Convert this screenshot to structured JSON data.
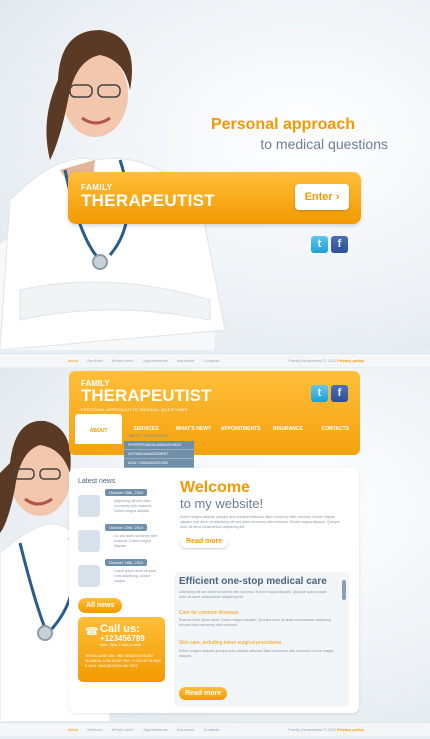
{
  "hero": {
    "tagline_line1": "Personal approach",
    "tagline_line2": "to medical questions",
    "brand_small": "FAMILY",
    "brand_big": "THERAPEUTIST",
    "enter_label": "Enter ›",
    "twitter_glyph": "t",
    "facebook_glyph": "f"
  },
  "footer": {
    "links": [
      "about",
      "Services",
      "What's new?",
      "Appointments",
      "Insurance",
      "Contacts"
    ],
    "copyright": "Family therapeutist © 2011",
    "privacy": "Privacy policy"
  },
  "inner": {
    "brand_small": "FAMILY",
    "brand_big": "THERAPEUTIST",
    "brand_sub": "PERSONAL APPROACH TO MEDICAL QUESTIONS",
    "nav": [
      "ABOUT",
      "SERVICES",
      "WHAT'S NEW?",
      "APPOINTMENTS",
      "INSURANCE",
      "CONTACTS"
    ],
    "dropdown": [
      "OBESITY MANAGEMENT",
      "HYPERTENSION MANAGEMENT",
      "ASTHMA MANAGEMENT",
      "ADULT IMMUNIZATIONS"
    ],
    "latest_news": "Latest news",
    "news": [
      {
        "date": "October 28th, 2010",
        "text": "Adipiscing elit sed diam nonummy nibh euismod. Dolore magna aliquam."
      },
      {
        "date": "October 20th, 2010",
        "text": "Cu sed diam nonummy nibh euismod. Dolore magna aliquam."
      },
      {
        "date": "October 18th, 2010",
        "text": "Lorem ipsum dolor sit amet cons adipiscing. Dolore magna."
      }
    ],
    "all_news": "All news",
    "call_us": "Call us:",
    "phone": "+123456789",
    "hours": "9am - 9pm, 7 days a week",
    "address": "28 HOLLAND OAK, 9807 MADISON ROAD ISLANDIA, 1238 MUSE FAX: +1 234 56 78 9900 E-MAIL: MAIL@DEMOLINK.ORG",
    "welcome": "Welcome",
    "to_website": "to my website!",
    "welcome_text": "Dolore magna aliquam quisque quis volutpat adiscsed diam nonummy nibh euismod. Dolore magna aliquam erat dolor sit adipiscing elit sed diam nonummy nibh euismod. Dolore magna aliquam. Quisque dolor sit amet consectetuer adipiscing elit.",
    "read_more": "Read more",
    "efficient": "Efficient one-stop medical care",
    "efficient_text": "Adipiscing elit sed diam nonummy nibh euismod. Dolore magna aliquam. Quisque quis volutpat dolor sit amet consectetuer adipiscing elit.",
    "care": "Care for common illnesses",
    "care_text": "Ruerum dolor ipsum amet. Dolore magna aliquam. Quisque dolor sit amet consectetuer adipiscing elit sed diam nonummy nibh euismod.",
    "skin": "Skin care, including minor surgical procedures",
    "skin_text": "Dolore magna aliquam quisque quis volutpat adiscsed diam nonummy nibh euismod. Dolore magna aliquam.",
    "read_more_2": "Read more"
  }
}
